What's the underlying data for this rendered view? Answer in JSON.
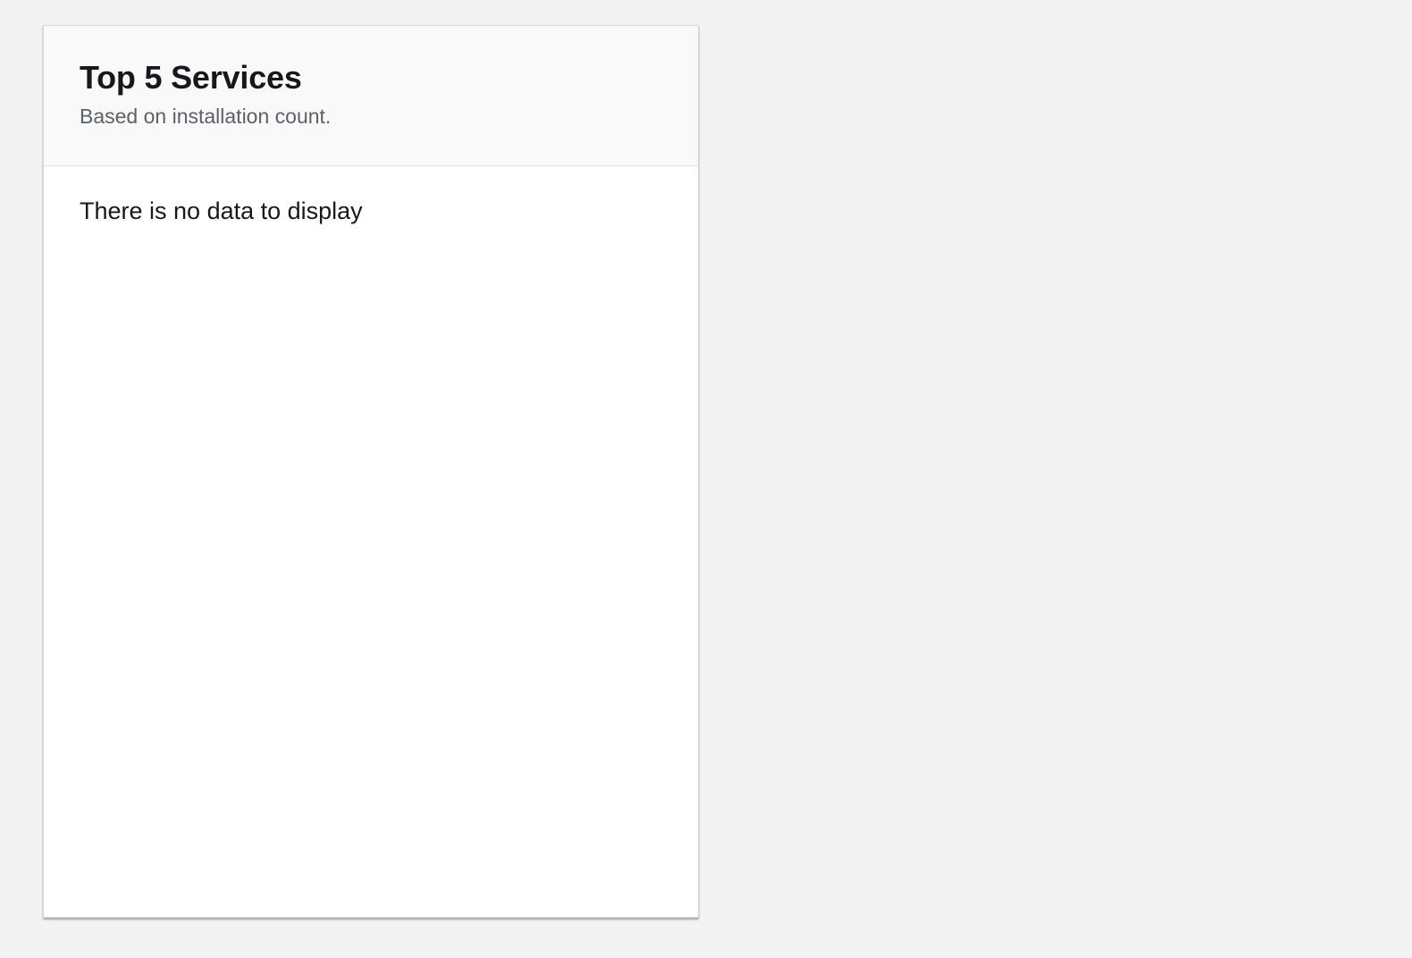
{
  "card": {
    "title": "Top 5 Services",
    "subtitle": "Based on installation count.",
    "empty_message": "There is no data to display"
  }
}
